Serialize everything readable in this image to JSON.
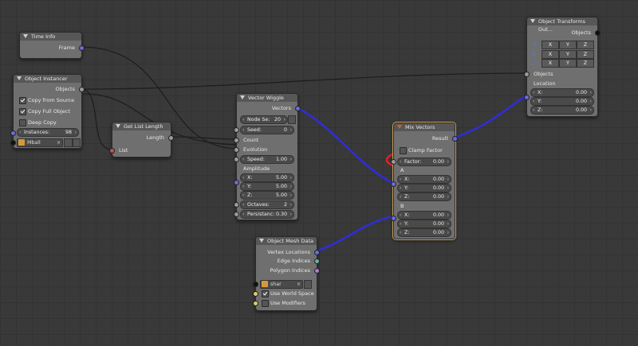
{
  "nodes": {
    "time_info": {
      "title": "Time Info",
      "output": "Frame"
    },
    "object_instancer": {
      "title": "Object Instancer",
      "output": "Objects",
      "copy_from_source": "Copy from Source",
      "copy_full_object": "Copy Full Object",
      "deep_copy": "Deep Copy",
      "instances_label": "Instances:",
      "instances_value": "98",
      "object_name": "Mball"
    },
    "get_list_length": {
      "title": "Get List Length",
      "output": "Length",
      "input": "List"
    },
    "vector_wiggle": {
      "title": "Vector Wiggle",
      "output": "Vectors",
      "node_seed_label": "Node Se:",
      "node_seed_value": "20",
      "seed_label": "Seed:",
      "seed_value": "0",
      "count": "Count",
      "evolution": "Evolution",
      "speed_label": "Speed:",
      "speed_value": "1.00",
      "amplitude": "Amplitude",
      "x_label": "X:",
      "x_value": "5.00",
      "y_label": "Y:",
      "y_value": "5.00",
      "z_label": "Z:",
      "z_value": "5.00",
      "octaves_label": "Octaves:",
      "octaves_value": "2",
      "persistance_label": "Persistanc:",
      "persistance_value": "0.30"
    },
    "object_mesh_data": {
      "title": "Object Mesh Data",
      "vertex_locations": "Vertex Locations",
      "edge_indices": "Edge Indices",
      "polygon_indices": "Polygon Indices",
      "object_name": "shar",
      "use_world_space": "Use World Space",
      "use_modifiers": "Use Modifiers"
    },
    "mix_vectors": {
      "title": "Mix Vectors",
      "output": "Result",
      "clamp_factor": "Clamp Factor",
      "factor_label": "Factor:",
      "factor_value": "0.00",
      "a": "A",
      "b": "B",
      "ax_label": "X:",
      "ax_value": "0.00",
      "ay_label": "Y:",
      "ay_value": "0.00",
      "az_label": "Z:",
      "az_value": "0.00",
      "bx_label": "X:",
      "bx_value": "0.00",
      "by_label": "Y:",
      "by_value": "0.00",
      "bz_label": "Z:",
      "bz_value": "0.00"
    },
    "object_transforms_output": {
      "title": "Object Transforms Out...",
      "objects_out": "Objects",
      "x": "X",
      "y": "Y",
      "z": "Z",
      "objects_in": "Objects",
      "location": "Location",
      "lx_label": "X:",
      "lx_value": "0.00",
      "ly_label": "Y:",
      "ly_value": "0.00",
      "lz_label": "Z:",
      "lz_value": "0.00"
    }
  },
  "colors": {
    "background": "#393939",
    "node_body": "#6f6f6f",
    "node_header": "#575757",
    "vector_socket": "#6b6bd8",
    "selected_link": "#3b3bd0",
    "highlight_annotation": "#e0202a",
    "selected_outline": "#c9a05a"
  },
  "icons": [
    "cube-icon",
    "close-icon",
    "eyedropper-icon",
    "dice-icon",
    "location-icon",
    "rotation-icon",
    "scale-icon"
  ]
}
